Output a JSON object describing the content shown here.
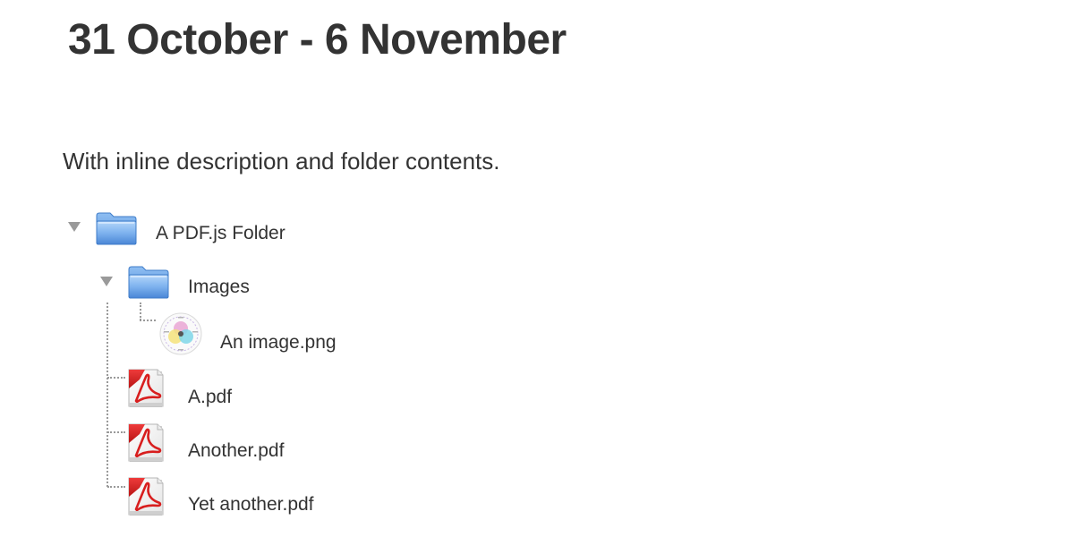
{
  "section": {
    "title": "31 October - 6 November",
    "summary": "With inline description and folder contents."
  },
  "folder_tree": {
    "root": {
      "name": "A PDF.js Folder",
      "icon": "folder-icon",
      "expanded": true,
      "children": {
        "subfolder": {
          "name": "Images",
          "icon": "folder-icon",
          "expanded": true,
          "files": [
            {
              "name": "An image.png",
              "icon": "image-thumbnail-icon"
            }
          ]
        },
        "files": [
          {
            "name": "A.pdf",
            "icon": "pdf-file-icon"
          },
          {
            "name": "Another.pdf",
            "icon": "pdf-file-icon"
          },
          {
            "name": "Yet another.pdf",
            "icon": "pdf-file-icon"
          }
        ]
      }
    }
  },
  "colors": {
    "text": "#333333",
    "tree_lines": "#9a9a9a",
    "folder_blue": "#5b9be6",
    "pdf_red": "#d81e1e"
  }
}
